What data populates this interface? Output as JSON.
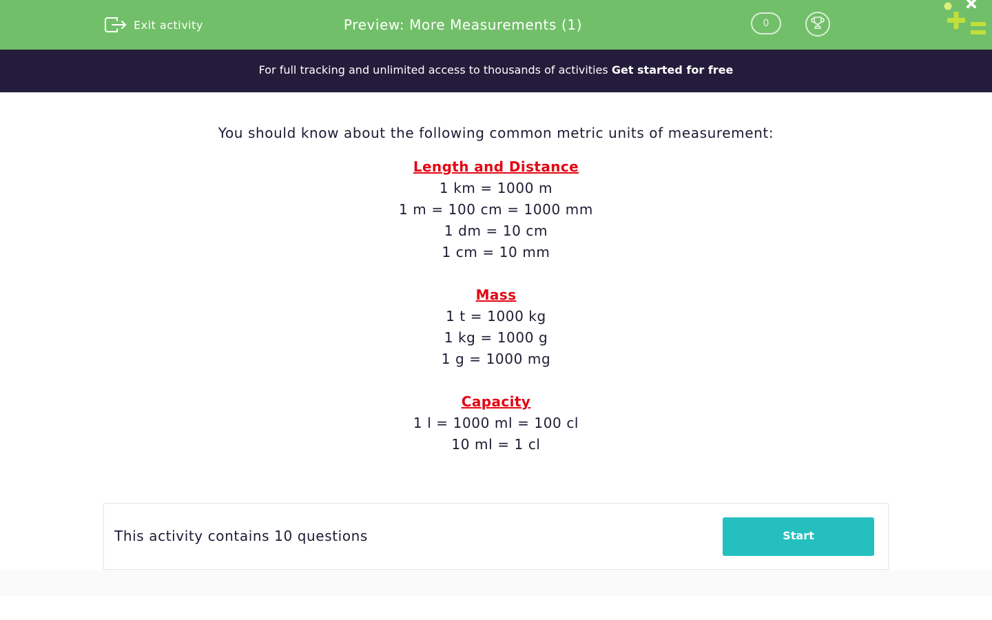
{
  "header": {
    "exit_label": "Exit activity",
    "title": "Preview: More Measurements (1)",
    "score": "0",
    "exit_icon": "exit-icon",
    "trophy_icon": "trophy-icon",
    "logo_icon": "brand-logo-icon"
  },
  "banner": {
    "text": "For full tracking and unlimited access to thousands of activities",
    "cta": "Get started for free"
  },
  "content": {
    "intro": "You should know about the following common metric units of measurement:",
    "sections": [
      {
        "heading": "Length and Distance",
        "lines": [
          "1 km = 1000 m",
          "1 m = 100 cm = 1000 mm",
          "1 dm = 10 cm",
          "1 cm = 10 mm"
        ]
      },
      {
        "heading": "Mass",
        "lines": [
          "1 t = 1000 kg",
          "1 kg = 1000 g",
          "1 g = 1000 mg"
        ]
      },
      {
        "heading": "Capacity",
        "lines": [
          "1 l = 1000 ml = 100 cl",
          "10 ml = 1 cl"
        ]
      }
    ]
  },
  "activity": {
    "summary": "This activity contains 10 questions",
    "start_label": "Start"
  },
  "colors": {
    "header_bg": "#72bf6a",
    "banner_bg": "#241c3b",
    "heading_red": "#e30613",
    "start_button": "#26bfbf",
    "text_dark": "#1e1a33"
  }
}
